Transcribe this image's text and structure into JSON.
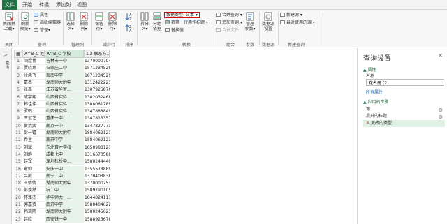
{
  "menu": [
    "文件",
    "开始",
    "转换",
    "添加列",
    "视图"
  ],
  "ribbon": {
    "close_upload": [
      "关闭并",
      "上载▾"
    ],
    "new_source": [
      "新建",
      "源▾"
    ],
    "recent_source": [
      "最近使",
      "用的源▾"
    ],
    "enter_data": [
      "输入",
      "数据"
    ],
    "refresh_preview": [
      "刷新",
      "预览▾"
    ],
    "properties": "属性",
    "advanced_editor": "高级编辑器",
    "manage": "管理▾",
    "choose_columns": [
      "选择",
      "列▾"
    ],
    "remove_columns": [
      "删除",
      "列▾"
    ],
    "keep_rows": [
      "保留",
      "行▾"
    ],
    "remove_rows": [
      "删除",
      "行▾"
    ],
    "split_column": [
      "拆分",
      "列▾"
    ],
    "group_by": [
      "分组",
      "依据"
    ],
    "data_type": "数据类型: 文本 ▾",
    "first_row_header": "将第一行用作标题 ▾",
    "replace_values": "替换值",
    "merge_queries": "合并查询 ▾",
    "append_queries": "追加查询 ▾",
    "combine_files": "合并文件",
    "manage_params": [
      "管理",
      "参数▾"
    ],
    "data_source_settings": [
      "数据源",
      "设置"
    ],
    "new_source2": "新建源 ▾",
    "recent_source2": "最近使用的源 ▾",
    "groups": {
      "close": "关闭",
      "query": "查询",
      "manage_columns": "管理列",
      "reduce_rows": "减少行",
      "sort": "排序",
      "transform": "转换",
      "combine": "组合",
      "parameters": "参数",
      "data_source": "数据源",
      "new_query": "新建查询"
    }
  },
  "queries_pane_label": "查询",
  "grid": {
    "headers": [
      "A^B_C 姓名",
      "A^B_C 学校",
      "1.2 联系方..."
    ],
    "rows": [
      [
        "1",
        "闫煜博",
        "吉林市一中",
        "13700007948"
      ],
      [
        "2",
        "贾晓玮",
        "石家庄二中",
        "15712345298"
      ],
      [
        "3",
        "段承飞",
        "海南中学",
        "18712345290"
      ],
      [
        "4",
        "戴杰",
        "湖南师大附中",
        "13124222234"
      ],
      [
        "5",
        "张鑫",
        "江苏省华罗...",
        "13079258765"
      ],
      [
        "6",
        "成宇翔",
        "山西省实验...",
        "13020324680"
      ],
      [
        "7",
        "韩佳伟",
        "山西省实验...",
        "13080817890"
      ],
      [
        "8",
        "罗鹤",
        "山西省实验...",
        "13478888495"
      ],
      [
        "9",
        "王冠艺",
        "重庆一中",
        "13478133577"
      ],
      [
        "10",
        "黄洪武",
        "南京一中",
        "13478277733"
      ],
      [
        "11",
        "彭一镭",
        "湖南师大附中",
        "18840621234"
      ],
      [
        "12",
        "乔里",
        "南开中学",
        "18840621234"
      ],
      [
        "13",
        "刘斌",
        "东北育才学校",
        "18509881234"
      ],
      [
        "14",
        "刘静",
        "成都七中",
        "13166705888"
      ],
      [
        "15",
        "赵军",
        "深圳杜桥中...",
        "15802444409"
      ],
      [
        "16",
        "章帅",
        "安庆一中",
        "13555788899"
      ],
      [
        "17",
        "吕威",
        "南宁二中",
        "13704038383"
      ],
      [
        "18",
        "王倩倩",
        "湖南师大附中",
        "13700002531"
      ],
      [
        "19",
        "彭焕然",
        "杭二中",
        "15897901051"
      ],
      [
        "20",
        "怀雅杰",
        "华中师大一...",
        "18440241111"
      ],
      [
        "21",
        "郭嘉资",
        "南开中学",
        "15804040228"
      ],
      [
        "22",
        "韩琦雨",
        "湖南师大附中",
        "15802456234"
      ],
      [
        "23",
        "赵欣",
        "西安铁一中",
        "15889256789"
      ]
    ]
  },
  "settings": {
    "title": "查询设置",
    "properties_header": "▲ 属性",
    "name_label": "名称",
    "name_value": "花名册 (2)",
    "all_properties": "所有属性",
    "applied_steps_header": "▲ 应用的步骤",
    "steps": [
      "源",
      "提升的标题",
      "更改的类型"
    ]
  },
  "colors": {
    "accent": "#217346",
    "highlight": "#d01010",
    "col_highlight": "#e8f3ec"
  }
}
